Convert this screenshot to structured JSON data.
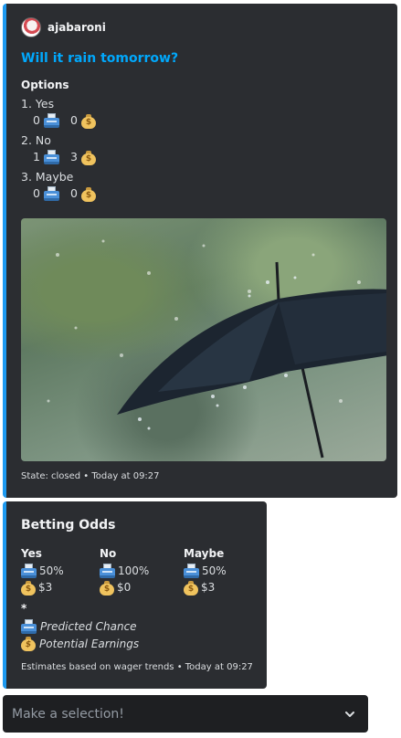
{
  "poll": {
    "author": "ajabaroni",
    "title": "Will it rain tomorrow?",
    "options_label": "Options",
    "options": [
      {
        "name": "1. Yes",
        "predicted": "0",
        "earnings": "0"
      },
      {
        "name": "2. No",
        "predicted": "1",
        "earnings": "3"
      },
      {
        "name": "3. Maybe",
        "predicted": "0",
        "earnings": "0"
      }
    ],
    "image_alt": "umbrella in rain",
    "footer": "State: closed • Today at 09:27"
  },
  "odds": {
    "title": "Betting Odds",
    "columns": [
      {
        "name": "Yes",
        "chance": "50%",
        "earnings": "$3"
      },
      {
        "name": "No",
        "chance": "100%",
        "earnings": "$0"
      },
      {
        "name": "Maybe",
        "chance": "50%",
        "earnings": "$3"
      }
    ],
    "asterisk": "*",
    "legend_chance": "Predicted Chance",
    "legend_earnings": "Potential Earnings",
    "footer": "Estimates based on wager trends • Today at 09:27"
  },
  "select": {
    "placeholder": "Make a selection!"
  },
  "icons": {
    "predicted": "fax-machine-icon",
    "earnings": "money-bag-icon",
    "dropdown": "chevron-down-icon"
  },
  "colors": {
    "accent": "#1e9af0",
    "title_link": "#00a8fc",
    "embed_bg": "#2b2d31",
    "select_bg": "#1e1f22"
  }
}
